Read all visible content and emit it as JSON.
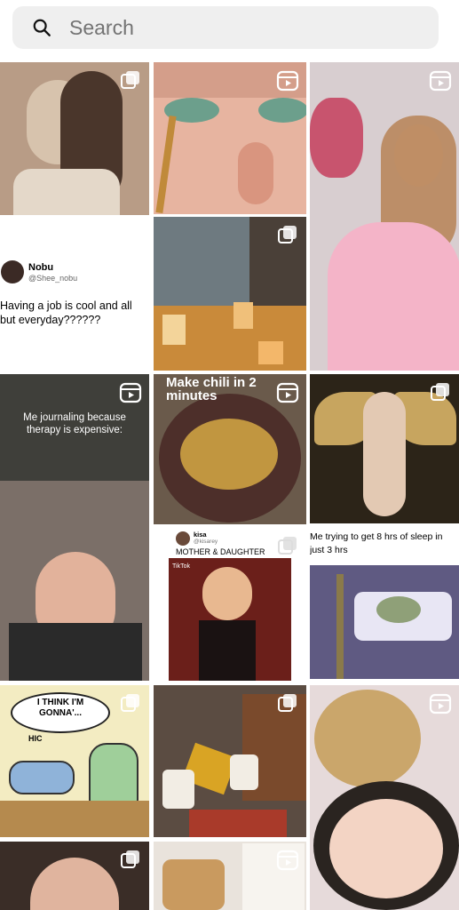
{
  "search": {
    "placeholder": "Search"
  },
  "tweet": {
    "name": "Nobu",
    "handle": "@Shee_nobu",
    "text": "Having a job is cool and all but everyday??????"
  },
  "journal": {
    "caption": "Me journaling because therapy is expensive:"
  },
  "recipe": {
    "caption": "Make chili in 2 minutes"
  },
  "kisa": {
    "name": "kisa",
    "handle": "@kisarey",
    "title": "MOTHER & DAUGHTER",
    "app": "TikTok"
  },
  "sleep": {
    "caption": "Me trying to get 8 hrs of sleep in just 3 hrs"
  },
  "comic": {
    "speech": "I THINK I'M GONNA'...",
    "hic": "HIC"
  },
  "colors": {
    "search_bg": "#efefef",
    "placeholder": "#737373"
  }
}
